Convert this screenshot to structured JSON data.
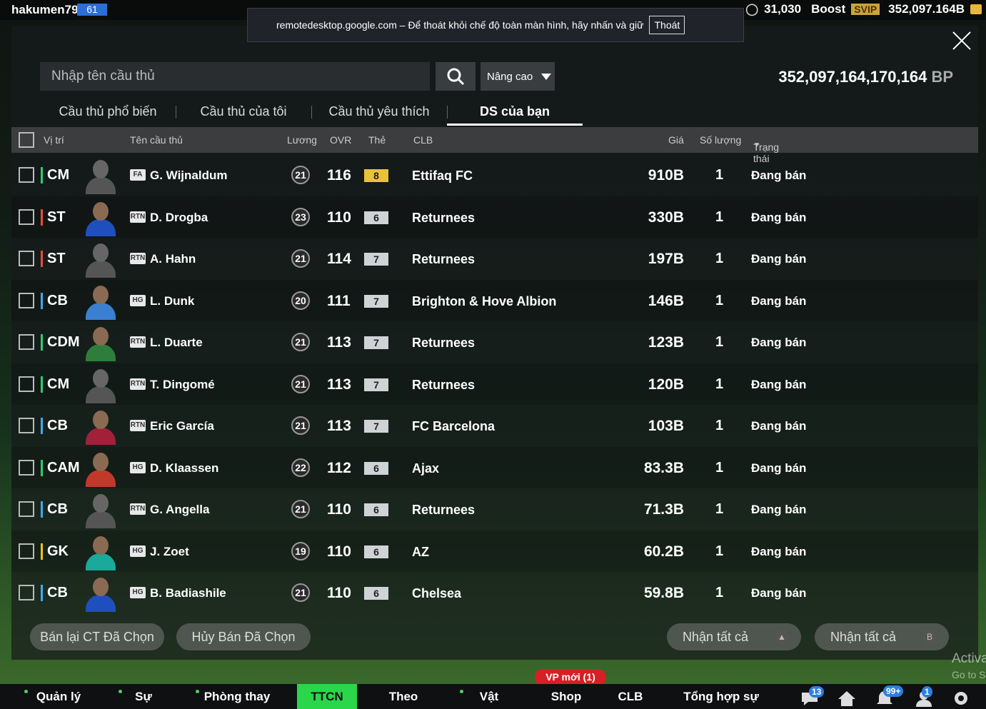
{
  "topbar": {
    "username": "hakumen79",
    "level": "61",
    "points": "31,030",
    "boost_label": "Boost",
    "svip_label": "SVIP",
    "balance": "352,097.164B"
  },
  "remote_notice": {
    "text": "remotedesktop.google.com – Để thoát khỏi chế độ toàn màn hình, hãy nhấn và giữ",
    "exit_label": "Thoát"
  },
  "search": {
    "placeholder": "Nhập tên cầu thủ",
    "advanced_label": "Nâng cao"
  },
  "bp": {
    "value": "352,097,164,170,164",
    "unit": "BP"
  },
  "tabs": [
    {
      "label": "Cầu thủ phổ biến",
      "active": false
    },
    {
      "label": "Cầu thủ của tôi",
      "active": false
    },
    {
      "label": "Cầu thủ yêu thích",
      "active": false
    },
    {
      "label": "DS của bạn",
      "active": true
    }
  ],
  "columns": {
    "position": "Vị trí",
    "name": "Tên cầu thủ",
    "wage": "Lương",
    "ovr": "OVR",
    "card": "Thẻ",
    "club": "CLB",
    "price": "Giá",
    "quantity": "Số lượng",
    "status": "Trạng thái"
  },
  "players": [
    {
      "pos": "CM",
      "pos_color": "#2ecc71",
      "season": "FA",
      "name": "G. Wijnaldum",
      "wage": "21",
      "ovr": "116",
      "card": "8",
      "card_color": "#e8c23a",
      "club": "Ettifaq FC",
      "price": "910B",
      "qty": "1",
      "status": "Đang bán",
      "has_photo": false
    },
    {
      "pos": "ST",
      "pos_color": "#e74c3c",
      "season": "RTN",
      "name": "D. Drogba",
      "wage": "23",
      "ovr": "110",
      "card": "6",
      "card_color": "#cfd3d6",
      "club": "Returnees",
      "price": "330B",
      "qty": "1",
      "status": "Đang bán",
      "has_photo": true,
      "kit": "#1f4fbf"
    },
    {
      "pos": "ST",
      "pos_color": "#e74c3c",
      "season": "RTN",
      "name": "A. Hahn",
      "wage": "21",
      "ovr": "114",
      "card": "7",
      "card_color": "#cfd3d6",
      "club": "Returnees",
      "price": "197B",
      "qty": "1",
      "status": "Đang bán",
      "has_photo": false
    },
    {
      "pos": "CB",
      "pos_color": "#3fa9f5",
      "season": "HG",
      "name": "L. Dunk",
      "wage": "20",
      "ovr": "111",
      "card": "7",
      "card_color": "#cfd3d6",
      "club": "Brighton & Hove Albion",
      "price": "146B",
      "qty": "1",
      "status": "Đang bán",
      "has_photo": true,
      "kit": "#3a7fd0"
    },
    {
      "pos": "CDM",
      "pos_color": "#2ecc71",
      "season": "RTN",
      "name": "L. Duarte",
      "wage": "21",
      "ovr": "113",
      "card": "7",
      "card_color": "#cfd3d6",
      "club": "Returnees",
      "price": "123B",
      "qty": "1",
      "status": "Đang bán",
      "has_photo": true,
      "kit": "#2f7d3a"
    },
    {
      "pos": "CM",
      "pos_color": "#2ecc71",
      "season": "RTN",
      "name": "T. Dingomé",
      "wage": "21",
      "ovr": "113",
      "card": "7",
      "card_color": "#cfd3d6",
      "club": "Returnees",
      "price": "120B",
      "qty": "1",
      "status": "Đang bán",
      "has_photo": false
    },
    {
      "pos": "CB",
      "pos_color": "#3fa9f5",
      "season": "RTN",
      "name": "Eric García",
      "wage": "21",
      "ovr": "113",
      "card": "7",
      "card_color": "#cfd3d6",
      "club": "FC Barcelona",
      "price": "103B",
      "qty": "1",
      "status": "Đang bán",
      "has_photo": true,
      "kit": "#a3203a"
    },
    {
      "pos": "CAM",
      "pos_color": "#2ecc71",
      "season": "HG",
      "name": "D. Klaassen",
      "wage": "22",
      "ovr": "112",
      "card": "6",
      "card_color": "#cfd3d6",
      "club": "Ajax",
      "price": "83.3B",
      "qty": "1",
      "status": "Đang bán",
      "has_photo": true,
      "kit": "#c0392b"
    },
    {
      "pos": "CB",
      "pos_color": "#3fa9f5",
      "season": "RTN",
      "name": "G. Angella",
      "wage": "21",
      "ovr": "110",
      "card": "6",
      "card_color": "#cfd3d6",
      "club": "Returnees",
      "price": "71.3B",
      "qty": "1",
      "status": "Đang bán",
      "has_photo": false
    },
    {
      "pos": "GK",
      "pos_color": "#f1c40f",
      "season": "HG",
      "name": "J. Zoet",
      "wage": "19",
      "ovr": "110",
      "card": "6",
      "card_color": "#cfd3d6",
      "club": "AZ",
      "price": "60.2B",
      "qty": "1",
      "status": "Đang bán",
      "has_photo": true,
      "kit": "#1aa99a"
    },
    {
      "pos": "CB",
      "pos_color": "#3fa9f5",
      "season": "HG",
      "name": "B. Badiashile",
      "wage": "21",
      "ovr": "110",
      "card": "6",
      "card_color": "#cfd3d6",
      "club": "Chelsea",
      "price": "59.8B",
      "qty": "1",
      "status": "Đang bán",
      "has_photo": true,
      "kit": "#1f4fbf"
    }
  ],
  "actions": {
    "resell_selected": "Bán lại CT Đã Chọn",
    "cancel_selected": "Hủy Bán Đã Chọn",
    "claim_all_1": "Nhận tất cả",
    "claim_all_2": "Nhận tất cả"
  },
  "watermark": {
    "line1": "Activa",
    "line2": "Go to S"
  },
  "bottom_nav": {
    "items": [
      "Quản lý CT",
      "Sự kiện",
      "Phòng thay đồ",
      "TTCN",
      "Theo dõi",
      "Vật phẩm",
      "Shop",
      "CLB",
      "Tổng hợp sự kiện"
    ],
    "vp_badge": "VP mới (1)",
    "chat_count": "13",
    "notif_count": "99+",
    "friend_count": "1"
  }
}
